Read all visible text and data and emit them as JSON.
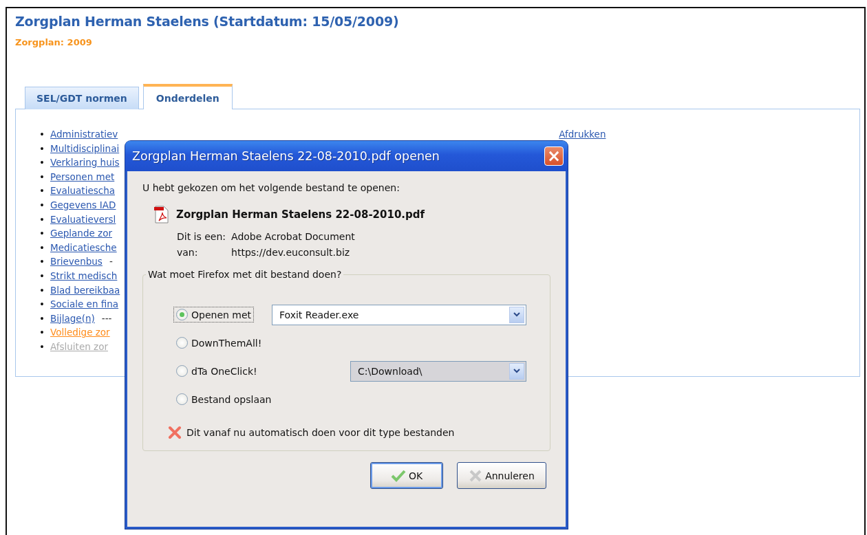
{
  "header": {
    "title": "Zorgplan Herman Staelens (Startdatum: 15/05/2009)",
    "subtitle": "Zorgplan: 2009"
  },
  "tabs": [
    {
      "label": "SEL/GDT normen",
      "selected": false
    },
    {
      "label": "Onderdelen",
      "selected": true
    }
  ],
  "sections": [
    {
      "bullet": "•",
      "label": "Administratiev",
      "kind": "normal",
      "extra_link": "Afdrukken"
    },
    {
      "bullet": "•",
      "label": "Multidisciplinai",
      "kind": "normal"
    },
    {
      "bullet": "•",
      "label": "Verklaring huis",
      "kind": "normal"
    },
    {
      "bullet": "•",
      "label": "Personen met",
      "kind": "normal"
    },
    {
      "bullet": "•",
      "label": "Evaluatiescha",
      "kind": "normal"
    },
    {
      "bullet": "•",
      "label": "Gegevens IAD",
      "kind": "normal"
    },
    {
      "bullet": "•",
      "label": "Evaluatieversl",
      "kind": "normal"
    },
    {
      "bullet": "•",
      "label": "Geplande zor",
      "kind": "normal"
    },
    {
      "bullet": "•",
      "label": "Medicatiesche",
      "kind": "normal"
    },
    {
      "bullet": "•",
      "label": "Brievenbus",
      "kind": "normal",
      "suffix": "-"
    },
    {
      "bullet": "•",
      "label": "Strikt medisch",
      "kind": "normal"
    },
    {
      "bullet": "•",
      "label": "Blad bereikbaa",
      "kind": "normal"
    },
    {
      "bullet": "•",
      "label": "Sociale en fina",
      "kind": "normal"
    },
    {
      "bullet": "•",
      "label": "Bijlage(n)",
      "kind": "normal",
      "suffix": "---"
    },
    {
      "bullet": "•",
      "label": "Volledige zor",
      "kind": "current"
    },
    {
      "bullet": "•",
      "label": "Afsluiten zor",
      "kind": "disabled"
    }
  ],
  "dialog": {
    "title": "Zorgplan Herman Staelens 22-08-2010.pdf openen",
    "close": "×",
    "intro": "U hebt gekozen om het volgende bestand te openen:",
    "file_name": "Zorgplan Herman Staelens 22-08-2010.pdf",
    "type_label": "Dit is een:",
    "type_value": "Adobe Acrobat Document",
    "from_label": "van:",
    "from_value": "https://dev.euconsult.biz",
    "group_label": "Wat moet Firefox met dit bestand doen?",
    "options": [
      {
        "label": "Openen met",
        "selected": true,
        "focused": true,
        "dropdown": {
          "value": "Foxit Reader.exe",
          "disabled": false
        }
      },
      {
        "label": "DownThemAll!",
        "selected": false,
        "focused": false
      },
      {
        "label": "dTa OneClick!",
        "selected": false,
        "focused": false,
        "dropdown": {
          "value": "C:\\Download\\",
          "disabled": true
        }
      },
      {
        "label": "Bestand opslaan",
        "selected": false,
        "focused": false
      }
    ],
    "remember": {
      "label": "Dit vanaf nu automatisch doen voor dit type bestanden",
      "checked": false
    },
    "buttons": [
      {
        "label": "OK",
        "kind": "ok",
        "default": true
      },
      {
        "label": "Annuleren",
        "kind": "cancel",
        "default": false
      }
    ]
  }
}
